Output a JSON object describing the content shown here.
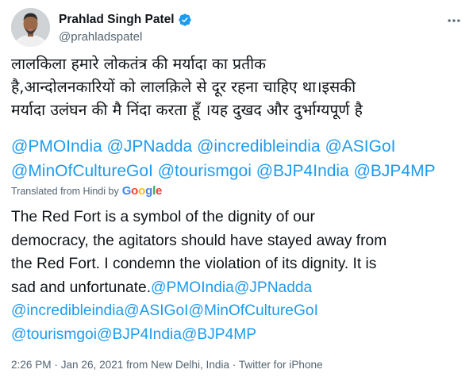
{
  "author": {
    "display_name": "Prahlad Singh Patel",
    "handle": "@prahladspatel",
    "verified": true
  },
  "more_icon": "more-horizontal-icon",
  "tweet": {
    "hindi_lines": [
      "लालकिला हमारे लोकतंत्र की मर्यादा का प्रतीक",
      "है,आन्दोलनकारियों को लालक़िले से दूर रहना चाहिए था।इसकी",
      "मर्यादा उलंघन की मै निंदा करता हूँ ।यह दुखद और दुर्भाग्यपूर्ण है"
    ],
    "mention_lines": [
      "@PMOIndia @JPNadda @incredibleindia @ASIGoI",
      "@MinOfCultureGoI @tourismgoi @BJP4India @BJP4MP"
    ]
  },
  "translation": {
    "label": "Translated from Hindi by",
    "provider": "Google",
    "lines": [
      {
        "text": "The Red Fort is a symbol of the dignity of our",
        "link": ""
      },
      {
        "text": "democracy, the agitators should have stayed away from",
        "link": ""
      },
      {
        "text": "the Red Fort. I condemn the violation of its dignity. It is",
        "link": ""
      },
      {
        "text": "sad and unfortunate.",
        "link": "@PMOIndia@JPNadda"
      },
      {
        "text": "",
        "link": "@incredibleindia@ASIGoI@MinOfCultureGoI"
      },
      {
        "text": "",
        "link": "@tourismgoi@BJP4India@BJP4MP"
      }
    ]
  },
  "meta": "2:26 PM · Jan 26, 2021 from New Delhi, India · Twitter for iPhone",
  "colors": {
    "link": "#1d9bf0",
    "secondary_text": "#536471",
    "primary_text": "#0f1419",
    "verified_badge": "#1d9bf0"
  }
}
